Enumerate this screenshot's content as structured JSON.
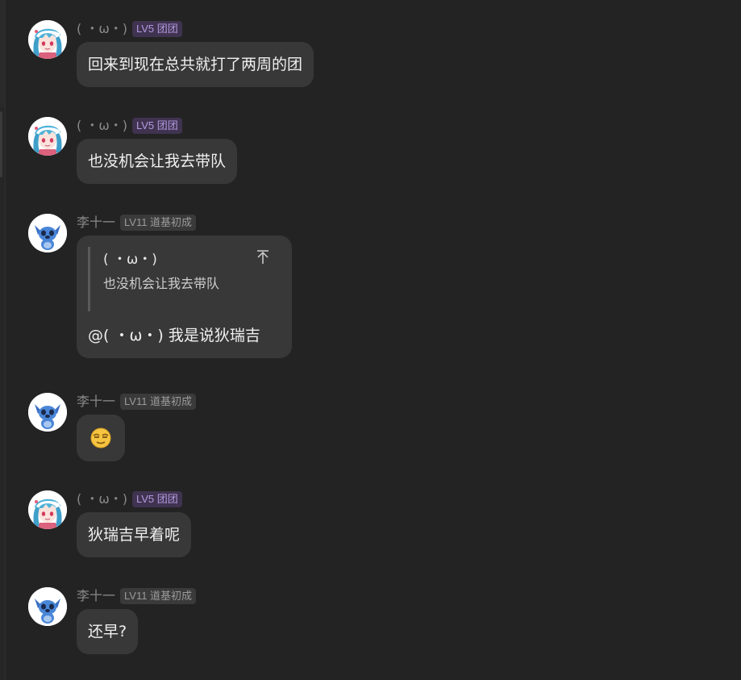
{
  "users": {
    "omega": {
      "nickname": "( ・ω・)",
      "badge": "LV5 团团"
    },
    "li": {
      "nickname": "李十一",
      "badge": "LV11 道基初成"
    }
  },
  "messages": [
    {
      "nickname": "( ・ω・)",
      "badge": "LV5 团团",
      "text": "回来到现在总共就打了两周的团"
    },
    {
      "nickname": "( ・ω・)",
      "badge": "LV5 团团",
      "text": "也没机会让我去带队"
    },
    {
      "nickname": "李十一",
      "badge": "LV11 道基初成",
      "quote": {
        "author": "( ・ω・)",
        "text": "也没机会让我去带队"
      },
      "text": "@( ・ω・) 我是说狄瑞吉"
    },
    {
      "nickname": "李十一",
      "badge": "LV11 道基初成",
      "emoji": "smug-face-emoji"
    },
    {
      "nickname": "( ・ω・)",
      "badge": "LV5 团团",
      "text": "狄瑞吉早着呢"
    },
    {
      "nickname": "李十一",
      "badge": "LV11 道基初成",
      "text": "还早?"
    }
  ],
  "colors": {
    "background": "#232323",
    "bubble": "#383838",
    "nickname": "#8a8a8a",
    "badge_lv5_bg": "#3f3350",
    "badge_lv5_text": "#b49ae0",
    "badge_lv11_bg": "#3a3a3a",
    "badge_lv11_text": "#9a9a9a"
  }
}
